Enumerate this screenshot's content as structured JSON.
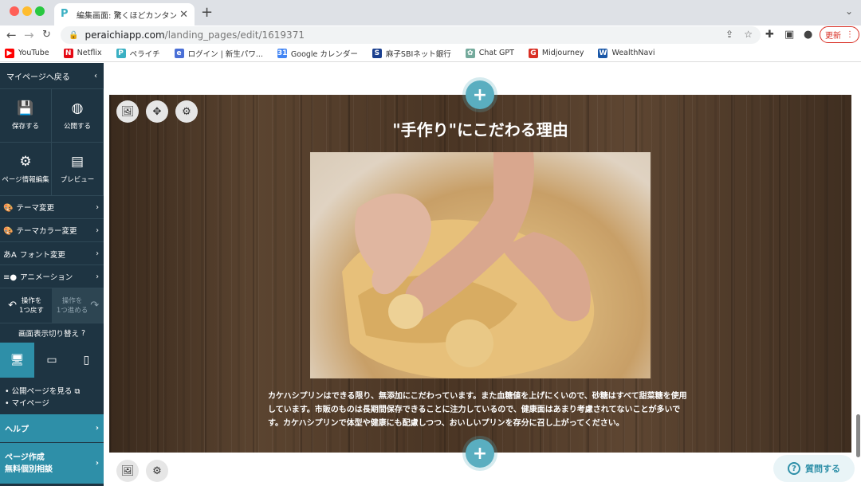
{
  "browser": {
    "tab_title": "編集画面: 驚くほどカンタン！無料",
    "url_host": "peraichiapp.com",
    "url_path": "/landing_pages/edit/1619371",
    "update_label": "更新",
    "bookmarks": [
      {
        "label": "YouTube",
        "color": "#ff0000",
        "glyph": "▶"
      },
      {
        "label": "Netflix",
        "color": "#e50914",
        "glyph": "N"
      },
      {
        "label": "ペライチ",
        "color": "#3ab0c3",
        "glyph": "P"
      },
      {
        "label": "ログイン | 新生パワ...",
        "color": "#4a6fd6",
        "glyph": "e"
      },
      {
        "label": "Google カレンダー",
        "color": "#4285f4",
        "glyph": "31"
      },
      {
        "label": "麻子SBIネット銀行",
        "color": "#1a3f8f",
        "glyph": "S"
      },
      {
        "label": "Chat GPT",
        "color": "#74aa9c",
        "glyph": "✿"
      },
      {
        "label": "Midjourney",
        "color": "#d93025",
        "glyph": "G"
      },
      {
        "label": "WealthNavi",
        "color": "#1b58a8",
        "glyph": "W"
      }
    ]
  },
  "sidebar": {
    "back_label": "マイページへ戻る",
    "save_label": "保存する",
    "publish_label": "公開する",
    "page_info_label": "ページ情報編集",
    "preview_label": "プレビュー",
    "menu": [
      {
        "label": "テーマ変更",
        "icon": "palette-icon"
      },
      {
        "label": "テーマカラー変更",
        "icon": "palette-color-icon"
      },
      {
        "label": "フォント変更",
        "icon": "font-icon"
      },
      {
        "label": "アニメーション",
        "icon": "animation-icon"
      }
    ],
    "undo_label_1": "操作を",
    "undo_label_2": "1つ戻す",
    "redo_label_1": "操作を",
    "redo_label_2": "1つ進める",
    "view_switch_label": "画面表示切り替え",
    "links": [
      "公開ページを見る",
      "マイページ"
    ],
    "help_label": "ヘルプ",
    "consult_label_1": "ページ作成",
    "consult_label_2": "無料個別相談"
  },
  "section": {
    "heading": "\"手作り\"にこだわる理由",
    "paragraph": "カケハシプリンはできる限り、無添加にこだわっています。また血糖値を上げにくいので、砂糖はすべて甜菜糖を使用しています。市販のものは長期間保存できることに注力しているので、健康面はあまり考慮されてないことが多いです。カケハシプリンで体型や健康にも配慮しつつ、おいしいプリンを存分に召し上がってください。"
  },
  "help_button_label": "質問する",
  "colors": {
    "sidebar": "#1e3442",
    "accent": "#2e8fa8",
    "add_button": "#5aaec0"
  }
}
